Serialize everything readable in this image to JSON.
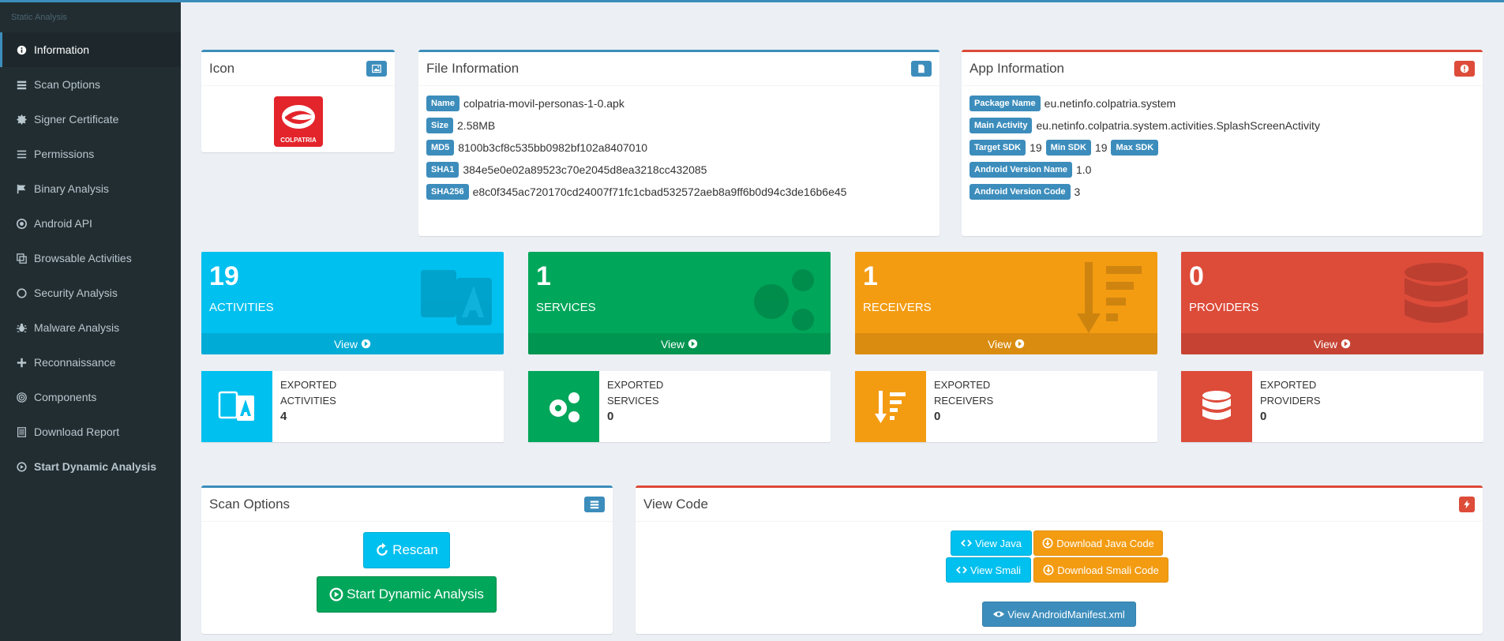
{
  "sidebar": {
    "header": "Static Analysis",
    "items": [
      {
        "label": "Information",
        "icon": "info-circle-icon"
      },
      {
        "label": "Scan Options",
        "icon": "server-icon"
      },
      {
        "label": "Signer Certificate",
        "icon": "certificate-icon"
      },
      {
        "label": "Permissions",
        "icon": "list-icon"
      },
      {
        "label": "Binary Analysis",
        "icon": "flag-icon"
      },
      {
        "label": "Android API",
        "icon": "dot-circle-icon"
      },
      {
        "label": "Browsable Activities",
        "icon": "clone-icon"
      },
      {
        "label": "Security Analysis",
        "icon": "circle-icon"
      },
      {
        "label": "Malware Analysis",
        "icon": "bug-icon"
      },
      {
        "label": "Reconnaissance",
        "icon": "plus-icon"
      },
      {
        "label": "Components",
        "icon": "bullseye-icon"
      },
      {
        "label": "Download Report",
        "icon": "file-icon"
      },
      {
        "label": "Start Dynamic Analysis",
        "icon": "play-circle-icon"
      }
    ]
  },
  "icon_box": {
    "title": "Icon",
    "app_logo_text": "COLPATRIA"
  },
  "file_info": {
    "title": "File Information",
    "name_label": "Name",
    "name": "colpatria-movil-personas-1-0.apk",
    "size_label": "Size",
    "size": "2.58MB",
    "md5_label": "MD5",
    "md5": "8100b3cf8c535bb0982bf102a8407010",
    "sha1_label": "SHA1",
    "sha1": "384e5e0e02a89523c70e2045d8ea3218cc432085",
    "sha256_label": "SHA256",
    "sha256": "e8c0f345ac720170cd24007f71fc1cbad532572aeb8a9ff6b0d94c3de16b6e45"
  },
  "app_info": {
    "title": "App Information",
    "package_label": "Package Name",
    "package": "eu.netinfo.colpatria.system",
    "main_activity_label": "Main Activity",
    "main_activity": "eu.netinfo.colpatria.system.activities.SplashScreenActivity",
    "target_sdk_label": "Target SDK",
    "target_sdk": "19",
    "min_sdk_label": "Min SDK",
    "min_sdk": "19",
    "max_sdk_label": "Max SDK",
    "max_sdk": "",
    "version_name_label": "Android Version Name",
    "version_name": "1.0",
    "version_code_label": "Android Version Code",
    "version_code": "3"
  },
  "stats": [
    {
      "count": "19",
      "label": "ACTIVITIES",
      "footer": "View",
      "color": "#00c0ef",
      "icon": "language-icon"
    },
    {
      "count": "1",
      "label": "SERVICES",
      "footer": "View",
      "color": "#00a65a",
      "icon": "cogs-icon"
    },
    {
      "count": "1",
      "label": "RECEIVERS",
      "footer": "View",
      "color": "#f39c12",
      "icon": "sort-amount-down-icon"
    },
    {
      "count": "0",
      "label": "PROVIDERS",
      "footer": "View",
      "color": "#dd4b39",
      "icon": "database-icon"
    }
  ],
  "exported": [
    {
      "line1": "EXPORTED",
      "line2": "ACTIVITIES",
      "count": "4"
    },
    {
      "line1": "EXPORTED",
      "line2": "SERVICES",
      "count": "0"
    },
    {
      "line1": "EXPORTED",
      "line2": "RECEIVERS",
      "count": "0"
    },
    {
      "line1": "EXPORTED",
      "line2": "PROVIDERS",
      "count": "0"
    }
  ],
  "scan_options": {
    "title": "Scan Options",
    "rescan": "Rescan",
    "start_dynamic": "Start Dynamic Analysis"
  },
  "view_code": {
    "title": "View Code",
    "view_java": "View Java",
    "download_java": "Download Java Code",
    "view_smali": "View Smali",
    "download_smali": "Download Smali Code",
    "view_manifest": "View AndroidManifest.xml"
  }
}
